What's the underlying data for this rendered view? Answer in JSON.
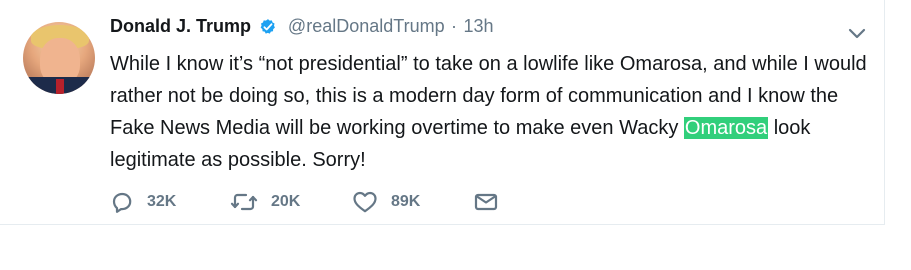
{
  "tweet": {
    "author_name": "Donald J. Trump",
    "handle": "@realDonaldTrump",
    "separator": "·",
    "time": "13h",
    "text_before": "While I know it’s “not presidential” to take on a lowlife like Omarosa, and while I would rather not be doing so, this is a modern day form of communication and I know the Fake News Media will be working overtime to make even Wacky ",
    "highlighted_text": "Omarosa",
    "text_after": " look legitimate as possible. Sorry!",
    "reply_count": "32K",
    "retweet_count": "20K",
    "like_count": "89K",
    "highlight_color": "#31cf7b",
    "verified_color": "#1da1f2",
    "icon_color": "#657786"
  },
  "icons": {
    "verified": "verified-badge-icon",
    "chevron": "chevron-down-icon",
    "reply": "reply-icon",
    "retweet": "retweet-icon",
    "like": "heart-icon",
    "dm": "mail-icon"
  }
}
